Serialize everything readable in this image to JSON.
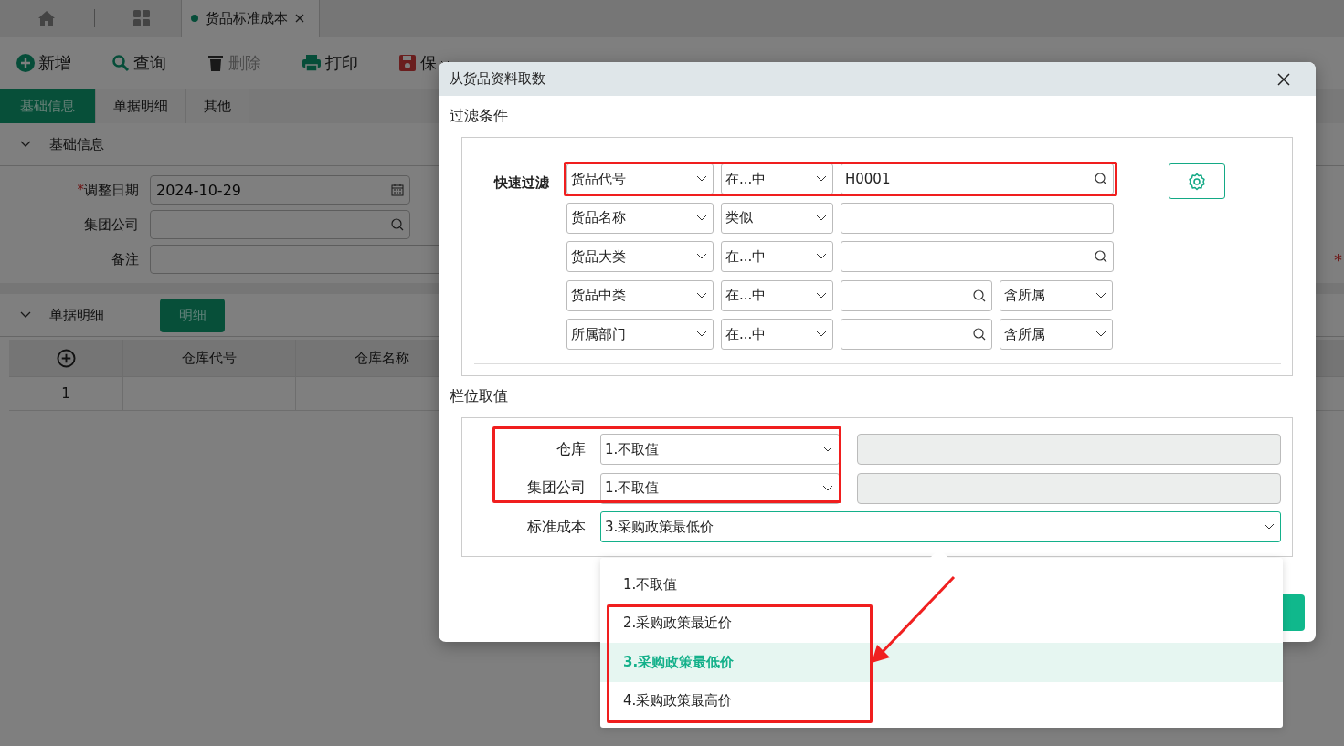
{
  "tabbar": {
    "tabs": [
      {
        "label": "货品标准成本",
        "selected": true
      }
    ]
  },
  "toolbar": [
    {
      "label": "新增",
      "kind": "add",
      "disabled": false,
      "caret": false
    },
    {
      "label": "查询",
      "kind": "search",
      "disabled": false,
      "caret": false
    },
    {
      "label": "删除",
      "kind": "delete",
      "disabled": true,
      "caret": false
    },
    {
      "label": "打印",
      "kind": "print",
      "disabled": false,
      "caret": false
    },
    {
      "label": "保",
      "kind": "save",
      "disabled": false,
      "caret": true
    }
  ],
  "form_tabs": [
    {
      "label": "基础信息",
      "selected": true
    },
    {
      "label": "单据明细",
      "selected": false
    },
    {
      "label": "其他",
      "selected": false
    }
  ],
  "basic_section": {
    "title": "基础信息",
    "fields": [
      {
        "label": "调整日期",
        "required_mark": "*",
        "kind": "date",
        "value": "2024-10-29"
      },
      {
        "label": "集团公司",
        "kind": "lookup"
      },
      {
        "label": "备注",
        "kind": "text",
        "side_mark": "*"
      }
    ]
  },
  "detail_section": {
    "title": "单据明细",
    "button": "明细",
    "columns": [
      "仓库代号",
      "仓库名称"
    ],
    "rows": [
      {
        "index": "1"
      }
    ]
  },
  "dialog": {
    "title": "从货品资料取数",
    "filter": {
      "title": "过滤条件",
      "label": "快速过滤",
      "rows": [
        {
          "field": "货品代号",
          "operator": "在...中",
          "value": "H0001",
          "lookup": true,
          "highlighted": true
        },
        {
          "field": "货品名称",
          "operator": "类似",
          "lookup": false,
          "highlighted": false
        },
        {
          "field": "货品大类",
          "operator": "在...中",
          "lookup": true,
          "highlighted": false
        },
        {
          "field": "货品中类",
          "operator": "在...中",
          "lookup": true,
          "scope": "含所属",
          "highlighted": false
        },
        {
          "field": "所属部门",
          "operator": "在...中",
          "lookup": true,
          "scope": "含所属",
          "highlighted": false
        }
      ]
    },
    "columns": {
      "title": "栏位取值",
      "rows": [
        {
          "label": "仓库",
          "value": "1.不取值",
          "extra": true,
          "focused": false,
          "highlighted": true
        },
        {
          "label": "集团公司",
          "value": "1.不取值",
          "extra": true,
          "focused": false,
          "highlighted": true
        },
        {
          "label": "标准成本",
          "value": "3.采购政策最低价",
          "extra": false,
          "focused": true,
          "highlighted": false
        }
      ]
    }
  },
  "dropdown": {
    "options": [
      {
        "label": "1.不取值",
        "selected": false,
        "highlighted": false
      },
      {
        "label": "2.采购政策最近价",
        "selected": false,
        "highlighted": true
      },
      {
        "label": "3.采购政策最低价",
        "selected": true,
        "highlighted": true
      },
      {
        "label": "4.采购政策最高价",
        "selected": false,
        "highlighted": true
      }
    ]
  }
}
